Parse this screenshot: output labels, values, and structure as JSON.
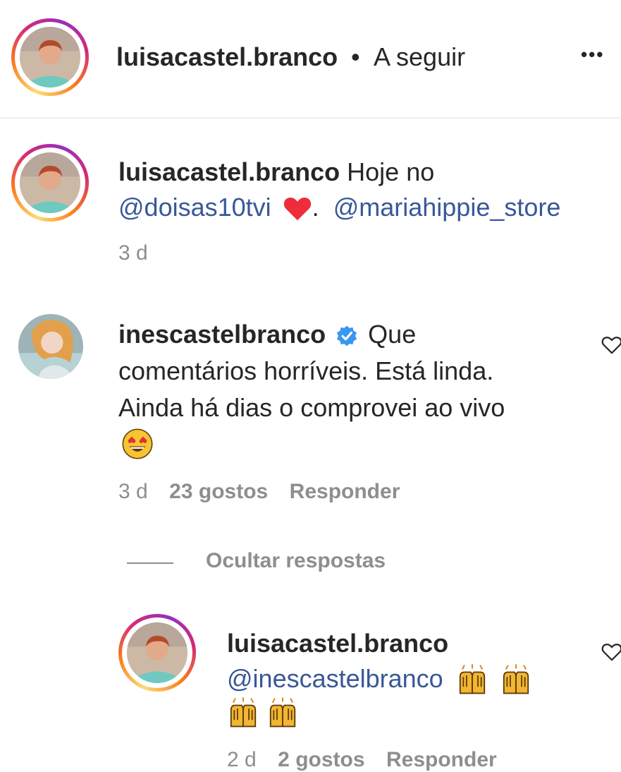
{
  "header": {
    "username": "luisacastel.branco",
    "separator": "•",
    "follow_label": "A seguir",
    "more_label": "•••"
  },
  "caption": {
    "username": "luisacastel.branco",
    "text_start": "Hoje no",
    "mention_1": "@doisas10tvi",
    "heart_emoji": "red-heart-icon",
    "after_heart": ".",
    "mention_2": "@mariahippie_store",
    "time": "3 d"
  },
  "comment": {
    "username": "inescastelbranco",
    "verified_icon": "verified-badge-icon",
    "text_line_1": "Que",
    "text_line_2": "comentários horríveis. Está linda.",
    "text_line_3": "Ainda há dias o comprovei ao vivo",
    "emoji": "heart-eyes-emoji",
    "time": "3 d",
    "likes": "23 gostos",
    "reply_label": "Responder"
  },
  "replies_toggle": {
    "label": "Ocultar respostas"
  },
  "reply": {
    "username": "luisacastel.branco",
    "mention": "@inescastelbranco",
    "emoji": "raising-hands-emoji",
    "time": "2 d",
    "likes": "2 gostos",
    "reply_label": "Responder"
  },
  "colors": {
    "text": "#262626",
    "muted": "#8e8e8e",
    "link": "#385898",
    "heart_red": "#ed4956",
    "verified_blue": "#3897f0"
  }
}
